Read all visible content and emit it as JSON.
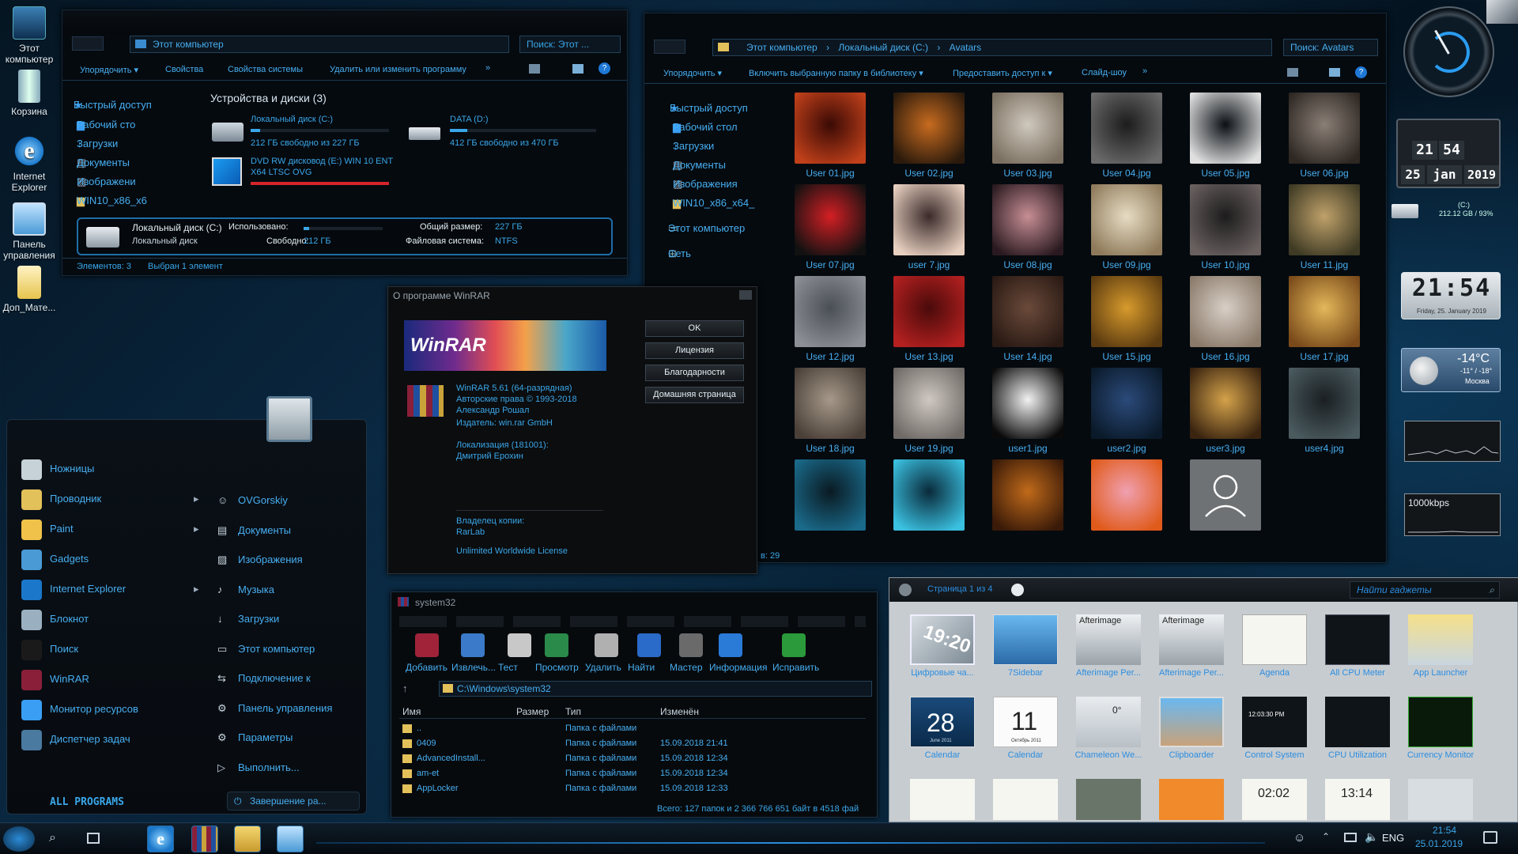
{
  "desktop_icons": [
    {
      "label": "Этот компьютер"
    },
    {
      "label": "Корзина"
    },
    {
      "label": "Internet Explorer"
    },
    {
      "label": "Панель управления"
    },
    {
      "label": "Доп_Мате..."
    }
  ],
  "explorer1": {
    "address": "Этот компьютер",
    "search": "Поиск: Этот ...",
    "toolbar": [
      "Упорядочить ▾",
      "Свойства",
      "Свойства системы",
      "Удалить или изменить программу",
      "»"
    ],
    "nav": [
      "Быстрый доступ",
      "Рабочий сто",
      "Загрузки",
      "Документы",
      "Изображени",
      "WIN10_x86_x6"
    ],
    "section": "Устройства и диски (3)",
    "drives": [
      {
        "name": "Локальный диск (C:)",
        "free": "212 ГБ свободно из 227 ГБ",
        "fill": 0.07
      },
      {
        "name": "DATA (D:)",
        "free": "412 ГБ свободно из 470 ГБ",
        "fill": 0.12
      },
      {
        "name": "DVD RW дисковод (E:) WIN 10 ENT X64 LTSC OVG",
        "free": "",
        "fill": 1.0
      }
    ],
    "details": {
      "name": "Локальный диск (C:)",
      "type": "Локальный диск",
      "used_label": "Использовано:",
      "free_label": "Свободно:",
      "free": "212 ГБ",
      "total_label": "Общий размер:",
      "total": "227 ГБ",
      "fs_label": "Файловая система:",
      "fs": "NTFS"
    },
    "status": [
      "Элементов: 3",
      "Выбран 1 элемент"
    ]
  },
  "explorer2": {
    "breadcrumb": [
      "Этот компьютер",
      "Локальный диск (C:)",
      "Avatars"
    ],
    "search": "Поиск: Avatars",
    "toolbar": [
      "Упорядочить ▾",
      "Включить выбранную папку в библиотеку ▾",
      "Предоставить доступ к ▾",
      "Слайд-шоу",
      "»"
    ],
    "nav": [
      "Быстрый доступ",
      "Рабочий стол",
      "Загрузки",
      "Документы",
      "Изображения",
      "WIN10_x86_x64_",
      "Этот компьютер",
      "Сеть"
    ],
    "files": [
      "User 01.jpg",
      "User 02.jpg",
      "User 03.jpg",
      "User 04.jpg",
      "User 05.jpg",
      "User 06.jpg",
      "User 07.jpg",
      "user 7.jpg",
      "User 08.jpg",
      "User 09.jpg",
      "User 10.jpg",
      "User 11.jpg",
      "User 12.jpg",
      "User 13.jpg",
      "User 14.jpg",
      "User 15.jpg",
      "User 16.jpg",
      "User 17.jpg",
      "User 18.jpg",
      "User 19.jpg",
      "user1.jpg",
      "user2.jpg",
      "user3.jpg",
      "user4.jpg",
      "",
      "",
      "",
      "",
      "",
      ""
    ],
    "status": "в: 29"
  },
  "gadget_clock": {
    "hour": "21",
    "min": "54",
    "day": "25",
    "month": "jan",
    "year": "2019"
  },
  "gadget_drive": {
    "label": "(C:)",
    "info": "212.12 GB / 93%"
  },
  "gadget_digital": {
    "time": "21:54",
    "date": "Friday, 25. January 2019"
  },
  "gadget_weather": {
    "temp": "-14°C",
    "range": "-11° / -18°",
    "city": "Москва"
  },
  "gadget_net": {
    "label": "1000kbps"
  },
  "winrar": {
    "title": "О программе WinRAR",
    "logo": "WinRAR",
    "buttons": [
      "OK",
      "Лицензия",
      "Благодарности",
      "Домашняя страница"
    ],
    "version": "WinRAR 5.61 (64-разрядная)",
    "copyright": "Авторские права © 1993-2018",
    "author": "Александр Рошал",
    "publisher": "Издатель: win.rar GmbH",
    "loc": "Локализация (181001):",
    "translator": "Дмитрий Ерохин",
    "owner_label": "Владелец копии:",
    "owner": "RarLab",
    "license": "Unlimited Worldwide License"
  },
  "start_menu": {
    "left": [
      "Ножницы",
      "Проводник",
      "Paint",
      "Gadgets",
      "Internet Explorer",
      "Блокнот",
      "Поиск",
      "WinRAR",
      "Монитор ресурсов",
      "Диспетчер задач"
    ],
    "right": [
      "OVGorskiy",
      "Документы",
      "Изображения",
      "Музыка",
      "Загрузки",
      "Этот компьютер",
      "Подключение к",
      "Панель управления",
      "Параметры",
      "Выполнить..."
    ],
    "all_programs": "ALL PROGRAMS",
    "shutdown": "Завершение ра..."
  },
  "winrar_main": {
    "title": "system32",
    "tools": [
      "Добавить",
      "Извлечь...",
      "Тест",
      "Просмотр",
      "Удалить",
      "Найти",
      "Мастер",
      "Информация",
      "Исправить"
    ],
    "path": "C:\\Windows\\system32",
    "columns": [
      "Имя",
      "Размер",
      "Тип",
      "Изменён"
    ],
    "rows": [
      {
        "name": "..",
        "type": "Папка с файлами",
        "date": ""
      },
      {
        "name": "0409",
        "type": "Папка с файлами",
        "date": "15.09.2018 21:41"
      },
      {
        "name": "AdvancedInstall...",
        "type": "Папка с файлами",
        "date": "15.09.2018 12:34"
      },
      {
        "name": "am-et",
        "type": "Папка с файлами",
        "date": "15.09.2018 12:34"
      },
      {
        "name": "AppLocker",
        "type": "Папка с файлами",
        "date": "15.09.2018 12:33"
      }
    ],
    "status": "Всего: 127 папок и 2 366 766 651 байт в 4518 фай"
  },
  "gadget_gallery": {
    "page": "Страница 1 из 4",
    "search": "Найти гаджеты",
    "items": [
      "Цифровые ча...",
      "7Sidebar",
      "Afterimage Per...",
      "Afterimage Per...",
      "Agenda",
      "All CPU Meter",
      "App Launcher",
      "Calendar",
      "Calendar",
      "Chameleon We...",
      "Clipboarder",
      "Control System",
      "CPU Utilization",
      "Currency Monitor"
    ],
    "afterimage": "Afterimage",
    "clock_time": "19:20",
    "cal1_num": "28",
    "cal2_num": "11",
    "cal1_label": "June 2011",
    "cal2_label": "Октябрь 2011",
    "weather_temp": "0°",
    "cs_time": "12:03:30 PM",
    "bottom_time": "02:02",
    "bottom_time2": "13:14"
  },
  "taskbar": {
    "lang": "ENG",
    "time": "21:54",
    "date": "25.01.2019"
  },
  "colors": {
    "accent": "#47aef0",
    "dark": "#050a0f",
    "border": "#1d3c55"
  }
}
